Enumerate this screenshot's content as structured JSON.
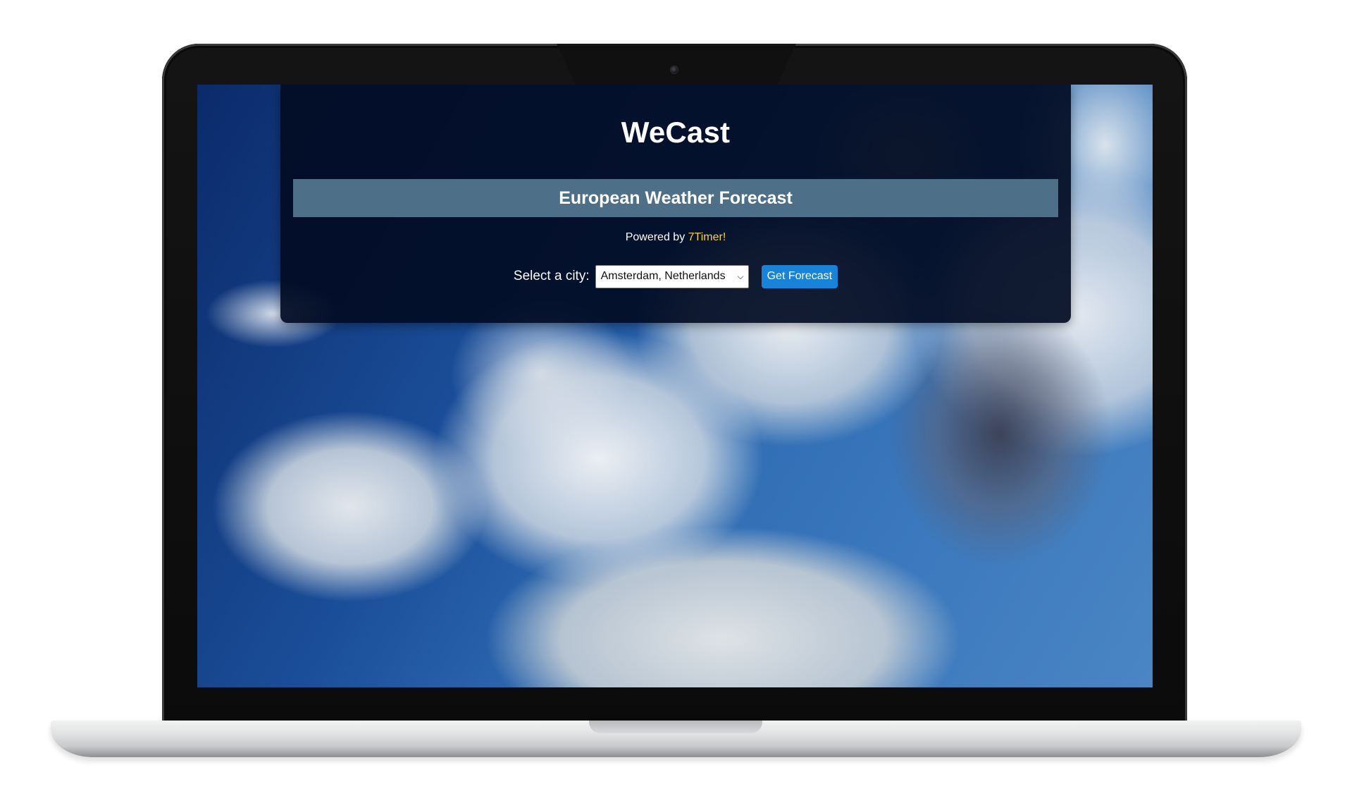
{
  "app": {
    "title": "WeCast",
    "subtitle": "European Weather Forecast",
    "powered_prefix": "Powered by",
    "powered_link": "7Timer!"
  },
  "form": {
    "city_label": "Select a city:",
    "city_selected": "Amsterdam, Netherlands",
    "submit_label": "Get Forecast"
  },
  "icons": {
    "select_chevron": "chevron-down-icon"
  },
  "colors": {
    "panel_bg": "#020c23",
    "subtitle_bar": "#4d6f87",
    "link": "#f5d33a",
    "button": "#1784d9"
  }
}
